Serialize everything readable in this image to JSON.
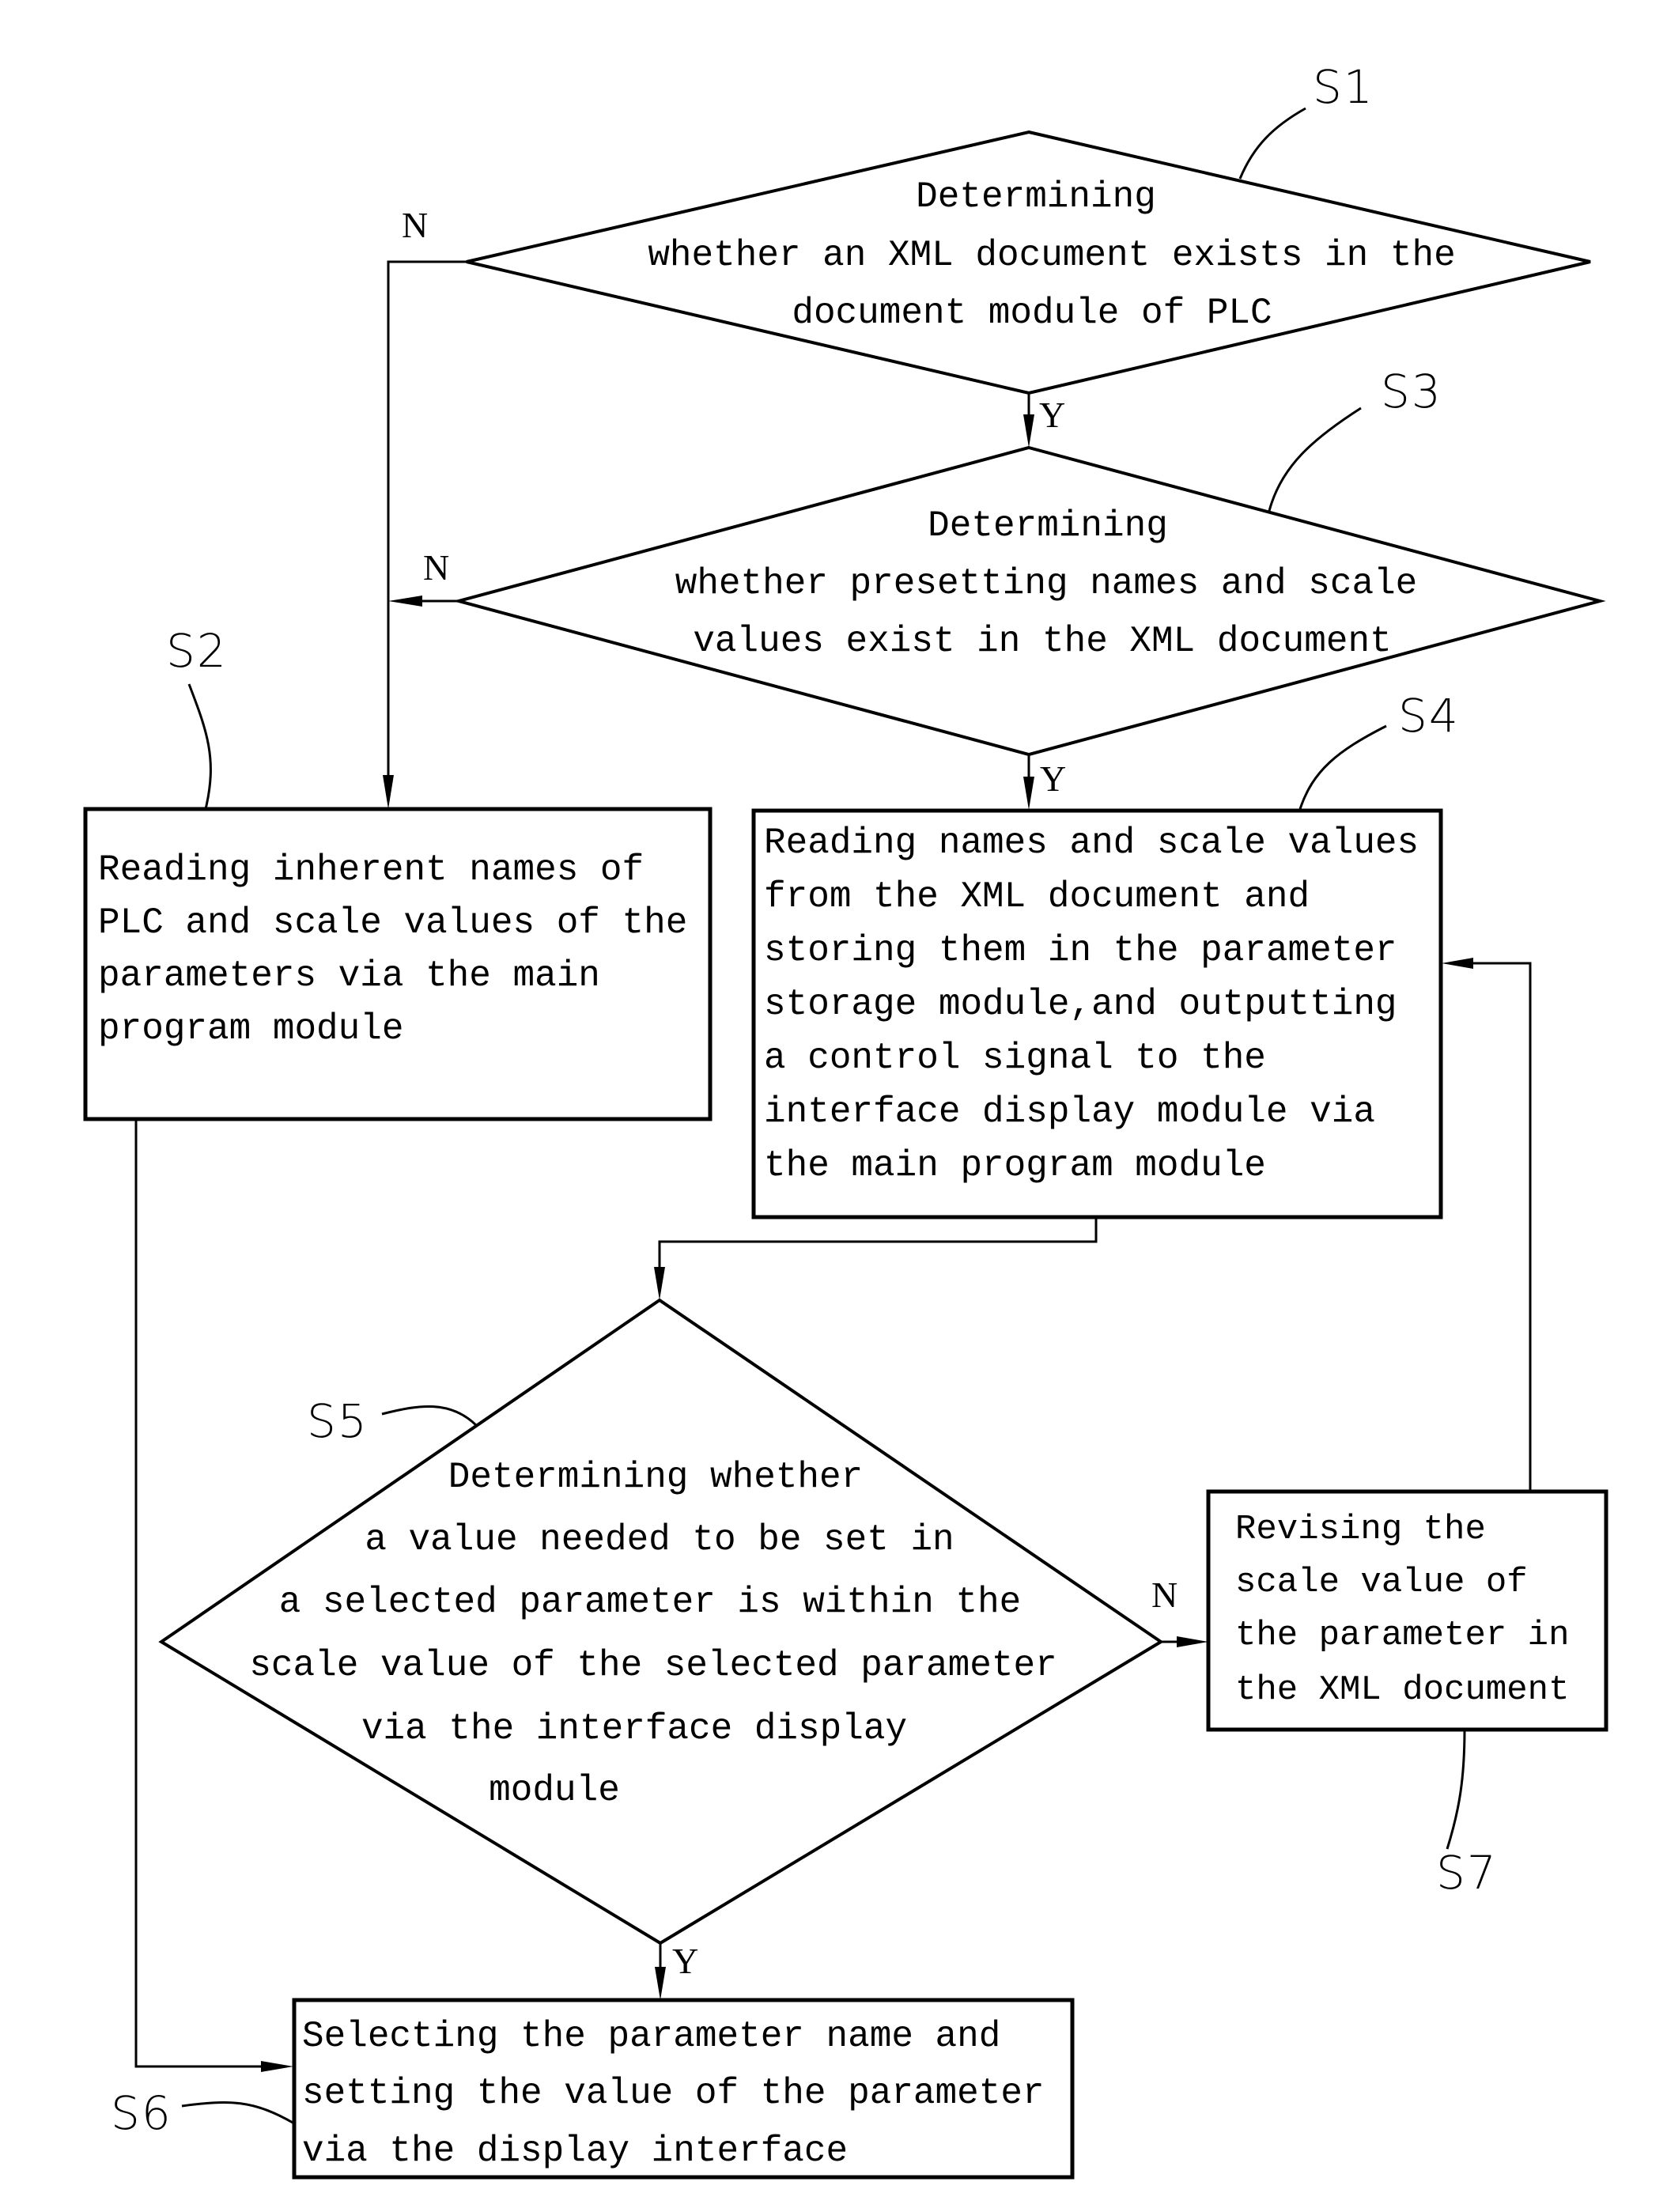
{
  "figure": {
    "type": "flowchart",
    "steps": {
      "s1": {
        "ref": "S1",
        "kind": "decision",
        "lines": [
          "Determining",
          "whether an XML document exists in the",
          "document module of PLC"
        ]
      },
      "s2": {
        "ref": "S2",
        "kind": "process",
        "lines": [
          "Reading inherent names of",
          "PLC and scale values of the",
          "parameters via the main",
          "program module"
        ]
      },
      "s3": {
        "ref": "S3",
        "kind": "decision",
        "lines": [
          "Determining",
          "whether presetting names and scale",
          "values exist in the XML document"
        ]
      },
      "s4": {
        "ref": "S4",
        "kind": "process",
        "lines": [
          "Reading names and scale values",
          "from the XML document and",
          "storing them in the parameter",
          "storage module,and outputting",
          "a control signal to the",
          "interface display module via",
          "the main program module"
        ]
      },
      "s5": {
        "ref": "S5",
        "kind": "decision",
        "lines": [
          "Determining whether",
          "a value needed to be set in",
          "a selected parameter is within the",
          "scale value of the selected parameter",
          "via the interface display",
          "module"
        ]
      },
      "s6": {
        "ref": "S6",
        "kind": "process",
        "lines": [
          "Selecting the parameter name and",
          "setting the value of the parameter",
          "via the display interface"
        ]
      },
      "s7": {
        "ref": "S7",
        "kind": "process",
        "lines": [
          "Revising the",
          "scale value of",
          "the parameter in",
          "the XML document"
        ]
      }
    },
    "branches": {
      "s1_no": "N",
      "s1_yes": "Y",
      "s3_no": "N",
      "s3_yes": "Y",
      "s5_no": "N",
      "s5_yes": "Y"
    },
    "edges": [
      {
        "from": "S1",
        "to": "S2",
        "label": "N"
      },
      {
        "from": "S1",
        "to": "S3",
        "label": "Y"
      },
      {
        "from": "S3",
        "to": "S2",
        "label": "N"
      },
      {
        "from": "S3",
        "to": "S4",
        "label": "Y"
      },
      {
        "from": "S4",
        "to": "S5",
        "label": ""
      },
      {
        "from": "S5",
        "to": "S7",
        "label": "N"
      },
      {
        "from": "S5",
        "to": "S6",
        "label": "Y"
      },
      {
        "from": "S7",
        "to": "S4",
        "label": ""
      },
      {
        "from": "S2",
        "to": "S6",
        "label": ""
      }
    ]
  }
}
